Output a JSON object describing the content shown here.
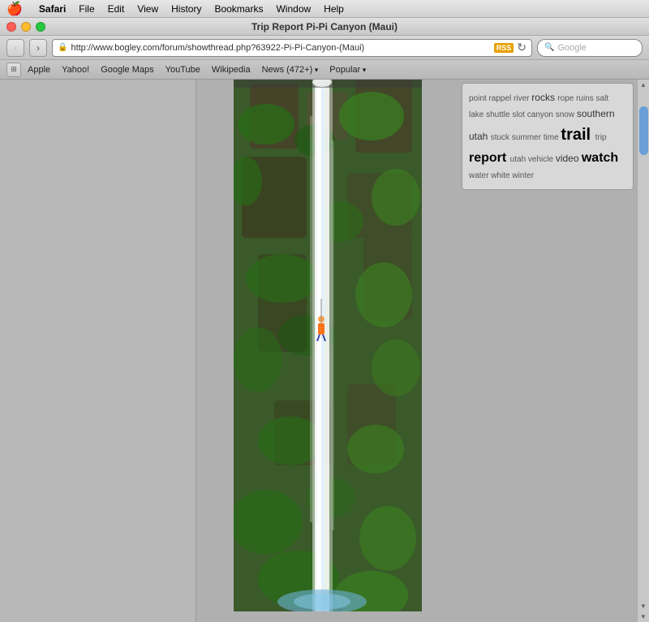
{
  "menubar": {
    "apple": "🍎",
    "items": [
      "Safari",
      "File",
      "Edit",
      "View",
      "History",
      "Bookmarks",
      "Window",
      "Help"
    ]
  },
  "titlebar": {
    "title": "Trip Report Pi-Pi Canyon (Maui)"
  },
  "toolbar": {
    "back_label": "‹",
    "forward_label": "›",
    "url": "http://www.bogley.com/forum/showthread.php?63922-Pi-Pi-Canyon-(Maui)",
    "rss": "RSS",
    "search_placeholder": "Google",
    "refresh": "↻",
    "lock_icon": "🔒"
  },
  "bookmarks": {
    "icon_label": "⊞",
    "items": [
      "Apple",
      "Yahoo!",
      "Google Maps",
      "YouTube",
      "Wikipedia"
    ],
    "dropdown_items": [
      "News (472+)",
      "Popular"
    ]
  },
  "tags": {
    "words": [
      {
        "text": "point",
        "size": "small"
      },
      {
        "text": "rappel",
        "size": "small"
      },
      {
        "text": "river",
        "size": "small"
      },
      {
        "text": "rocks",
        "size": "medium"
      },
      {
        "text": "rope",
        "size": "small"
      },
      {
        "text": "ruins",
        "size": "small"
      },
      {
        "text": "salt",
        "size": "small"
      },
      {
        "text": "lake",
        "size": "small"
      },
      {
        "text": "shuttle",
        "size": "small"
      },
      {
        "text": "slot",
        "size": "small"
      },
      {
        "text": "canyon",
        "size": "small"
      },
      {
        "text": "snow",
        "size": "small"
      },
      {
        "text": "southern",
        "size": "medium"
      },
      {
        "text": "utah",
        "size": "medium"
      },
      {
        "text": "stuck",
        "size": "small"
      },
      {
        "text": "summer",
        "size": "small"
      },
      {
        "text": "time",
        "size": "small"
      },
      {
        "text": "trail",
        "size": "xlarge"
      },
      {
        "text": "trip",
        "size": "small"
      },
      {
        "text": "report",
        "size": "large"
      },
      {
        "text": "utah",
        "size": "small"
      },
      {
        "text": "vehicle",
        "size": "small"
      },
      {
        "text": "video",
        "size": "medium"
      },
      {
        "text": "watch",
        "size": "large"
      },
      {
        "text": "water",
        "size": "small"
      },
      {
        "text": "white",
        "size": "small"
      },
      {
        "text": "winter",
        "size": "small"
      }
    ]
  }
}
